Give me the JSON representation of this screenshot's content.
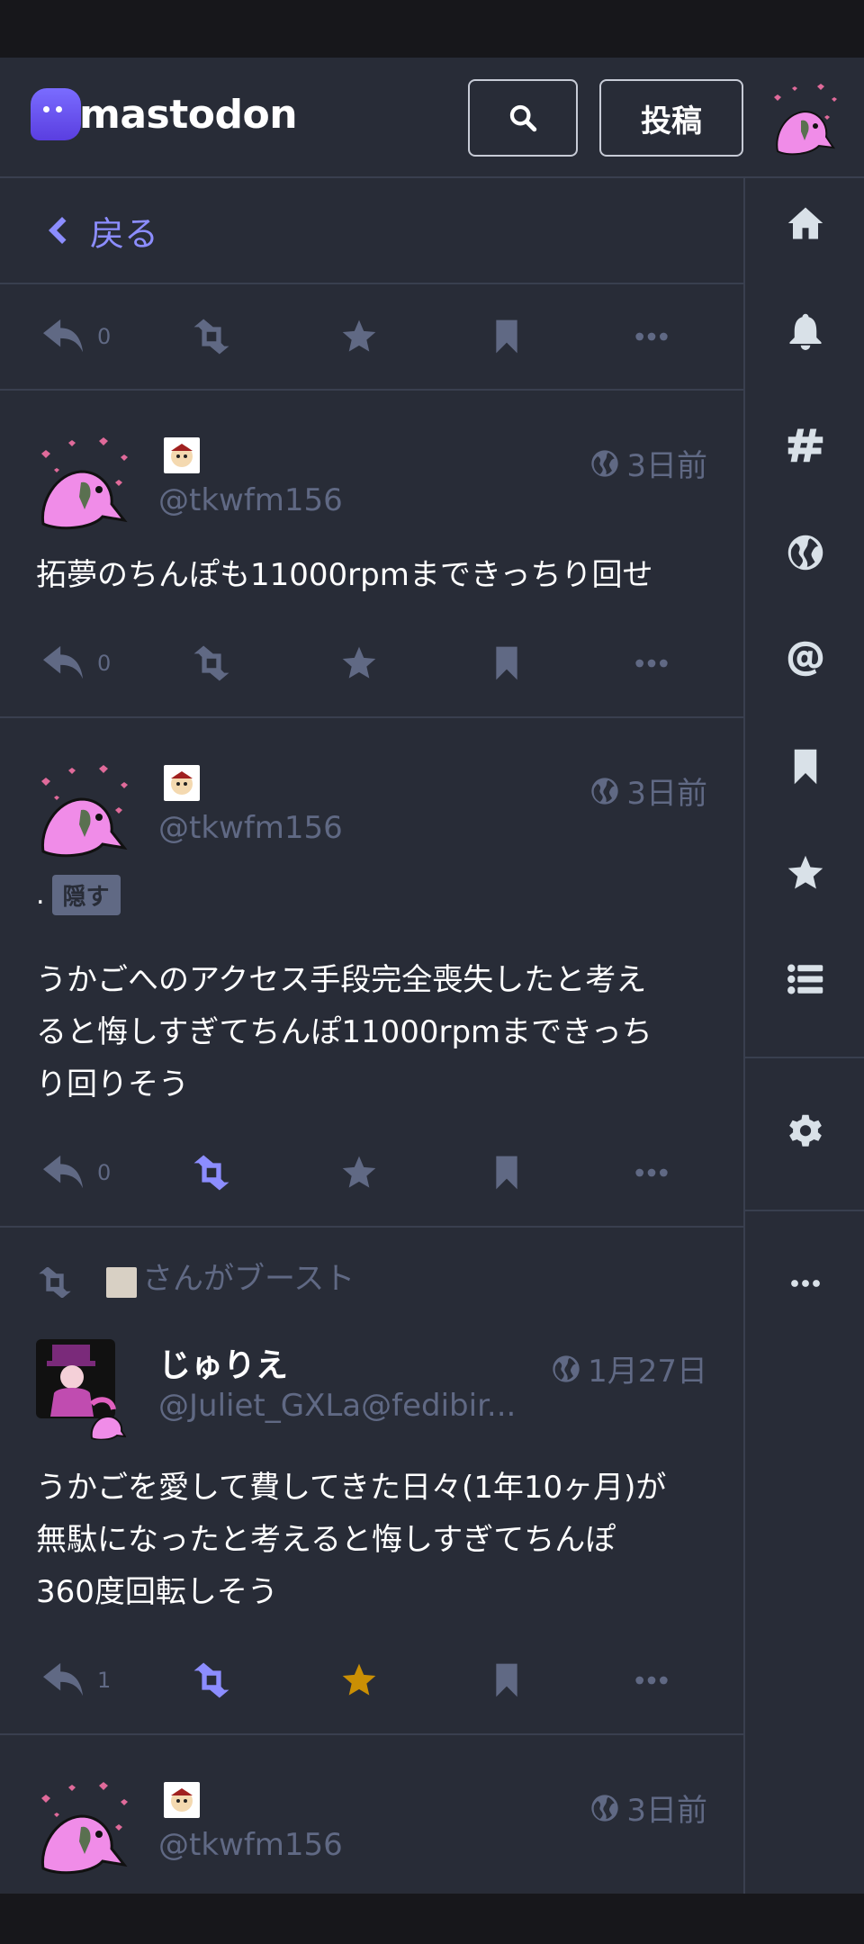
{
  "app": {
    "logo_text": "mastodon"
  },
  "header": {
    "search_icon": "search-icon",
    "post_label": "投稿"
  },
  "back": {
    "label": "戻る"
  },
  "colors": {
    "accent": "#8c8dff",
    "favourite": "#ca8f04",
    "muted": "#606984",
    "background": "#282c37"
  },
  "top_actions": {
    "reply_count": "0"
  },
  "sidebar": {
    "items": [
      "home-icon",
      "bell-icon",
      "hashtag-icon",
      "globe-icon",
      "at-icon",
      "bookmark-icon",
      "star-icon",
      "list-icon",
      "gear-icon",
      "more-icon"
    ]
  },
  "posts": [
    {
      "acct": "@tkwfm156",
      "time": "3日前",
      "content": "拓夢のちんぽも11000rpmまできっちり回せ",
      "reply_count": "0"
    },
    {
      "acct": "@tkwfm156",
      "time": "3日前",
      "cw_text": ".",
      "cw_button": "隠す",
      "content_lines": [
        "うかごへのアクセス手段完全喪失したと考え",
        "ると悔しすぎてちんぽ11000rpmまできっち",
        "り回りそう"
      ],
      "reply_count": "0"
    },
    {
      "boost_text": "さんがブースト",
      "display_name": "じゅりえ",
      "acct": "@Juliet_GXLa@fedibir...",
      "time": "1月27日",
      "content_lines": [
        "うかごを愛して費してきた日々(1年10ヶ月)が",
        "無駄になったと考えると悔しすぎてちんぽ",
        "360度回転しそう"
      ],
      "reply_count": "1"
    },
    {
      "acct": "@tkwfm156",
      "time": "3日前"
    }
  ]
}
